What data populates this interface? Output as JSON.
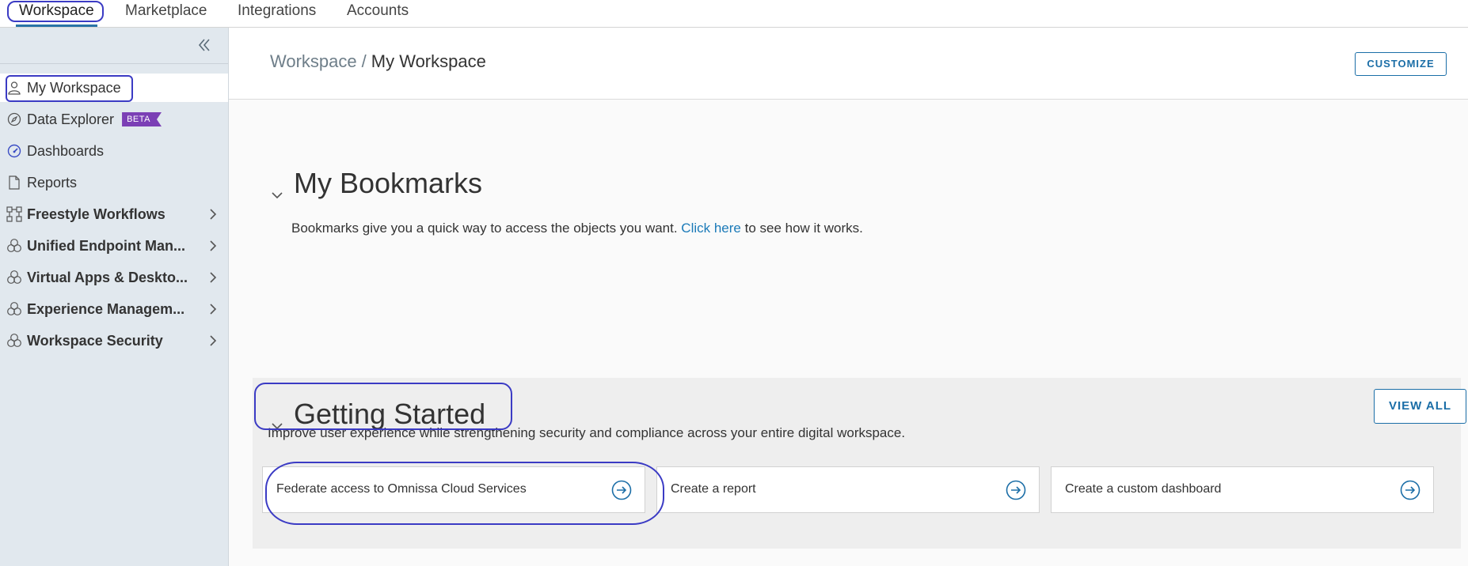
{
  "topnav": {
    "tabs": [
      {
        "label": "Workspace",
        "active": true
      },
      {
        "label": "Marketplace",
        "active": false
      },
      {
        "label": "Integrations",
        "active": false
      },
      {
        "label": "Accounts",
        "active": false
      }
    ]
  },
  "sidebar": {
    "collapse_icon": "double-chevron-left-icon",
    "items": [
      {
        "label": "My Workspace",
        "icon": "user-icon",
        "selected": true
      },
      {
        "label": "Data Explorer",
        "icon": "compass-icon",
        "badge": "BETA"
      },
      {
        "label": "Dashboards",
        "icon": "dashboard-gauge-icon"
      },
      {
        "label": "Reports",
        "icon": "document-icon"
      },
      {
        "label": "Freestyle Workflows",
        "icon": "workflow-icon",
        "expandable": true
      },
      {
        "label": "Unified Endpoint Man...",
        "icon": "product-circles-icon",
        "expandable": true
      },
      {
        "label": "Virtual Apps & Deskto...",
        "icon": "product-circles-icon",
        "expandable": true
      },
      {
        "label": "Experience Managem...",
        "icon": "product-circles-icon",
        "expandable": true
      },
      {
        "label": "Workspace Security",
        "icon": "product-circles-icon",
        "expandable": true
      }
    ]
  },
  "header": {
    "breadcrumb_root": "Workspace",
    "breadcrumb_sep": "/",
    "breadcrumb_current": "My Workspace",
    "customize_label": "CUSTOMIZE"
  },
  "bookmarks": {
    "title": "My Bookmarks",
    "desc_before": "Bookmarks give you a quick way to access the objects you want. ",
    "link_text": "Click here",
    "desc_after": " to see how it works."
  },
  "getting_started": {
    "title": "Getting Started",
    "view_all_label": "VIEW ALL",
    "desc": "Improve user experience while strengthening security and compliance across your entire digital workspace.",
    "cards": [
      {
        "title": "Federate access to Omnissa Cloud Services"
      },
      {
        "title": "Create a report"
      },
      {
        "title": "Create a custom dashboard"
      }
    ]
  },
  "colors": {
    "accent": "#1b6ea7",
    "sidebar_bg": "#e1e8ee",
    "annotation": "#3b3bc4",
    "beta_badge": "#7b3fb5"
  }
}
